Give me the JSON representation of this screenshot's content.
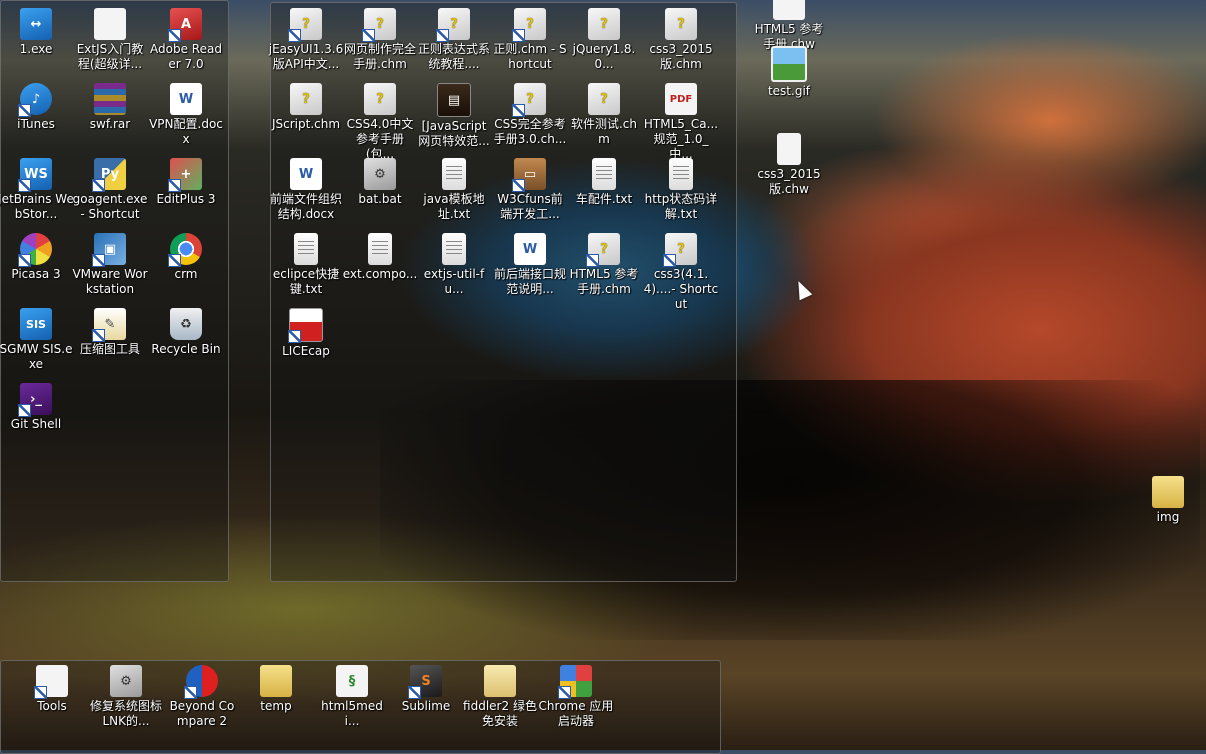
{
  "desktop": {
    "left_group": [
      {
        "label": "1.exe",
        "icon": "teamviewer-icon"
      },
      {
        "label": "ExtJS入门教程(超级详...",
        "icon": "blank-doc-icon"
      },
      {
        "label": "Adobe Reader 7.0",
        "icon": "adobe-reader-icon"
      },
      {
        "label": "iTunes",
        "icon": "itunes-icon"
      },
      {
        "label": "swf.rar",
        "icon": "winrar-icon"
      },
      {
        "label": "VPN配置.docx",
        "icon": "word-doc-icon"
      },
      {
        "label": "JetBrains WebStor...",
        "icon": "webstorm-icon"
      },
      {
        "label": "goagent.exe - Shortcut",
        "icon": "python-icon"
      },
      {
        "label": "EditPlus 3",
        "icon": "editplus-icon"
      },
      {
        "label": "Picasa 3",
        "icon": "picasa-icon"
      },
      {
        "label": "VMware Workstation",
        "icon": "vmware-icon"
      },
      {
        "label": "crm",
        "icon": "chrome-icon"
      },
      {
        "label": "SGMW SIS.exe",
        "icon": "sis-icon"
      },
      {
        "label": "压缩图工具",
        "icon": "tool-doc-icon"
      },
      {
        "label": "Recycle Bin",
        "icon": "recycle-bin-icon"
      },
      {
        "label": "Git Shell",
        "icon": "git-shell-icon"
      }
    ],
    "middle_group": [
      {
        "label": "jEasyUI1.3.6版API中文...",
        "icon": "chm-icon"
      },
      {
        "label": "网页制作完全手册.chm",
        "icon": "chm-icon"
      },
      {
        "label": "正则表达式系统教程....",
        "icon": "chm-icon"
      },
      {
        "label": "正则.chm - Shortcut",
        "icon": "chm-icon"
      },
      {
        "label": "jQuery1.8.0...",
        "icon": "chm-icon"
      },
      {
        "label": "css3_2015版.chm",
        "icon": "chm-icon"
      },
      {
        "label": "JScript.chm",
        "icon": "chm-icon"
      },
      {
        "label": "CSS4.0中文参考手册(包...",
        "icon": "chm-icon"
      },
      {
        "label": "[JavaScript网页特效范...",
        "icon": "book-icon"
      },
      {
        "label": "CSS完全参考手册3.0.ch...",
        "icon": "chm-icon"
      },
      {
        "label": "软件测试.chm",
        "icon": "chm-icon"
      },
      {
        "label": "HTML5_Ca...规范_1.0_中...",
        "icon": "pdf-icon"
      },
      {
        "label": "前端文件组织结构.docx",
        "icon": "word-doc-icon"
      },
      {
        "label": "bat.bat",
        "icon": "batch-icon"
      },
      {
        "label": "java模板地址.txt",
        "icon": "text-file-icon"
      },
      {
        "label": "W3Cfuns前端开发工...",
        "icon": "briefcase-icon"
      },
      {
        "label": "车配件.txt",
        "icon": "text-file-icon"
      },
      {
        "label": "http状态码详解.txt",
        "icon": "text-file-icon"
      },
      {
        "label": "eclipce快捷键.txt",
        "icon": "text-file-icon"
      },
      {
        "label": "ext.compo...",
        "icon": "text-file-icon"
      },
      {
        "label": "extjs-util-fu...",
        "icon": "text-file-icon"
      },
      {
        "label": "前后端接口规范说明...",
        "icon": "word-doc-icon"
      },
      {
        "label": "HTML5 参考手册.chm",
        "icon": "chm-icon"
      },
      {
        "label": "css3(4.1.4)....- Shortcut",
        "icon": "chm-icon"
      },
      {
        "label": "LICEcap",
        "icon": "licecap-icon"
      }
    ],
    "right_column": [
      {
        "label": "HTML5 参考手册.chw",
        "icon": "blank-doc-icon"
      },
      {
        "label": "test.gif",
        "icon": "image-icon"
      },
      {
        "label": "css3_2015版.chw",
        "icon": "blank-doc-icon"
      },
      {
        "label": "img",
        "icon": "folder-icon"
      }
    ],
    "bottom_group": [
      {
        "label": "Tools",
        "icon": "shortcut-doc-icon"
      },
      {
        "label": "修复系统图标LNK的...",
        "icon": "gear-doc-icon"
      },
      {
        "label": "Beyond Compare 2",
        "icon": "beyond-compare-icon"
      },
      {
        "label": "temp",
        "icon": "folder-icon"
      },
      {
        "label": "html5medi...",
        "icon": "script-icon"
      },
      {
        "label": "Sublime",
        "icon": "sublime-icon"
      },
      {
        "label": "fiddler2 绿色免安装",
        "icon": "folder-icon"
      },
      {
        "label": "Chrome 应用启动器",
        "icon": "chrome-apps-icon"
      }
    ]
  }
}
